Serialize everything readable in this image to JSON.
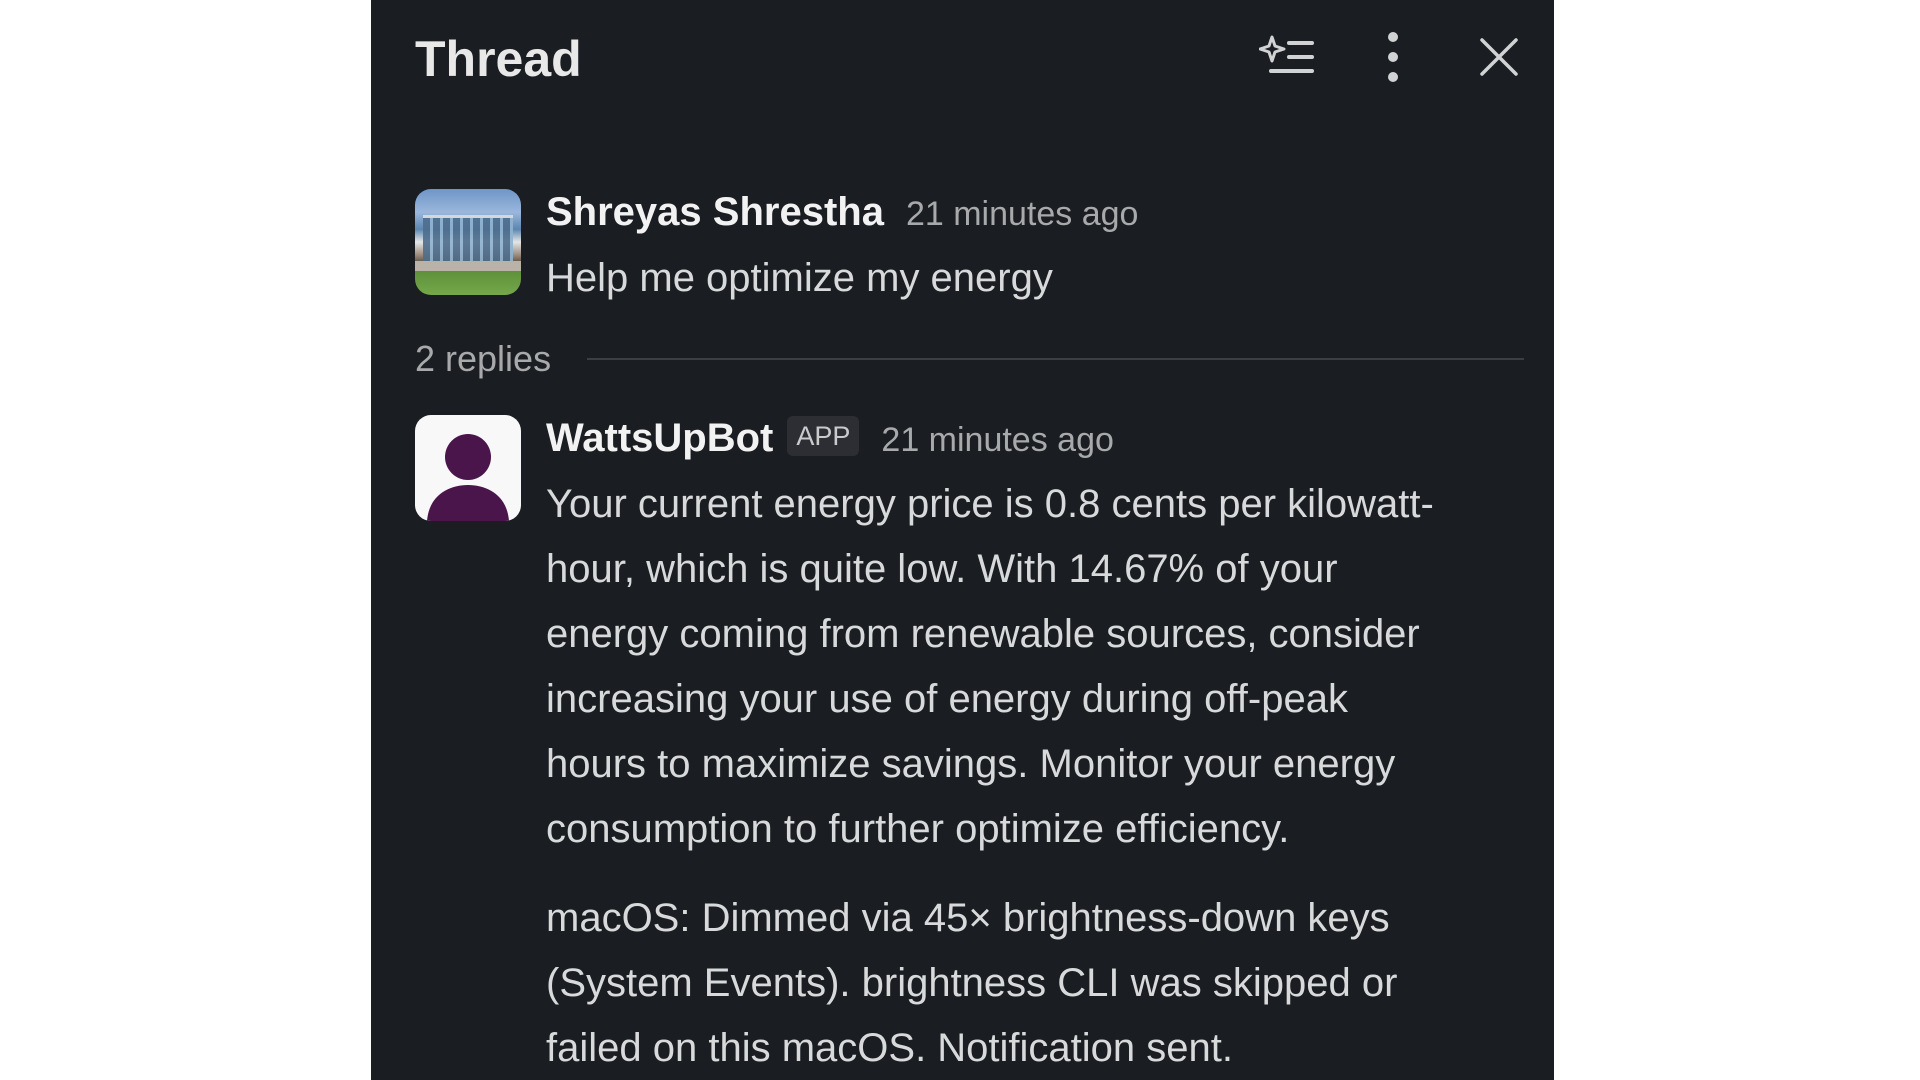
{
  "header": {
    "title": "Thread",
    "icons": [
      "ai-summary-icon",
      "more-options-icon",
      "close-icon"
    ]
  },
  "messages": [
    {
      "author": "Shreyas Shrestha",
      "timestamp": "21 minutes ago",
      "text": "Help me optimize my energy"
    },
    {
      "author": "WattsUpBot",
      "badge": "APP",
      "timestamp": "21 minutes ago",
      "text": "Your current energy price is 0.8 cents per kilowatt-\nhour, which is quite low. With 14.67% of your\nenergy coming from renewable sources, consider\nincreasing your use of energy during off-peak\nhours to maximize savings. Monitor your energy\nconsumption to further optimize efficiency.",
      "text2": "macOS: Dimmed via 45× brightness-down keys\n(System Events). brightness CLI was skipped or\nfailed on this macOS. Notification sent."
    }
  ],
  "replies": {
    "label": "2 replies"
  },
  "colors": {
    "panel_bg": "#1a1d21",
    "bot_avatar_purple": "#4a154b"
  }
}
